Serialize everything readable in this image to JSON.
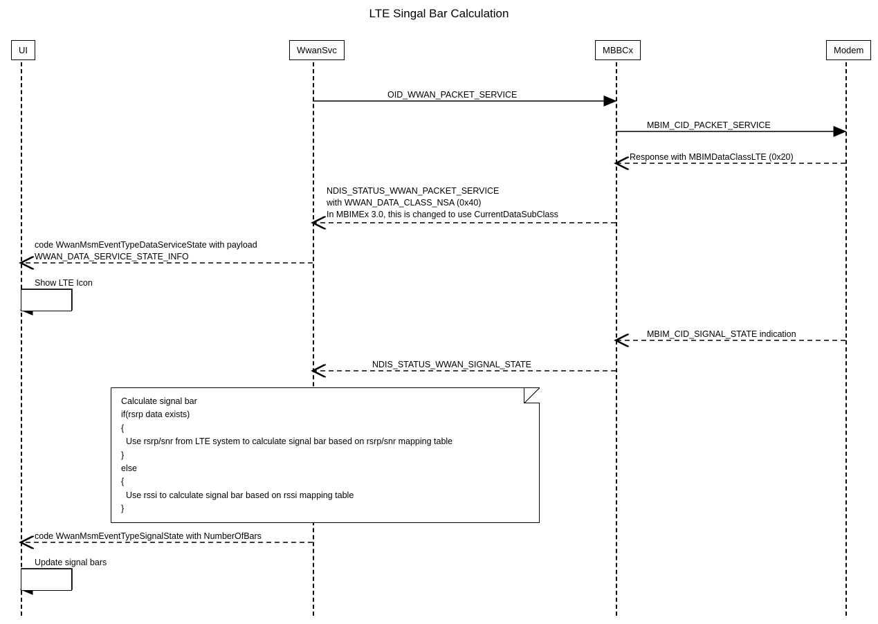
{
  "title": "LTE Singal Bar Calculation",
  "actors": {
    "ui": "UI",
    "wwansvc": "WwanSvc",
    "mbbcx": "MBBCx",
    "modem": "Modem"
  },
  "messages": {
    "m1": "OID_WWAN_PACKET_SERVICE",
    "m2": "MBIM_CID_PACKET_SERVICE",
    "m3": "Response with MBIMDataClassLTE (0x20)",
    "m4_l1": "NDIS_STATUS_WWAN_PACKET_SERVICE",
    "m4_l2": "with WWAN_DATA_CLASS_NSA (0x40)",
    "m4_l3": "In MBIMEx 3.0, this is changed to use CurrentDataSubClass",
    "m5_l1": "code WwanMsmEventTypeDataServiceState with payload",
    "m5_l2": "WWAN_DATA_SERVICE_STATE_INFO",
    "m6": "Show LTE Icon",
    "m7": "MBIM_CID_SIGNAL_STATE indication",
    "m8": "NDIS_STATUS_WWAN_SIGNAL_STATE",
    "m9": "code WwanMsmEventTypeSignalState with NumberOfBars",
    "m10": "Update signal bars"
  },
  "note": {
    "l1": "Calculate signal bar",
    "l2": "if(rsrp data exists)",
    "l3": "{",
    "l4": "  Use rsrp/snr from LTE system to calculate signal bar based on rsrp/snr mapping table",
    "l5": "}",
    "l6": "else",
    "l7": "{",
    "l8": "  Use rssi to calculate signal bar based on rssi mapping table",
    "l9": "}"
  }
}
